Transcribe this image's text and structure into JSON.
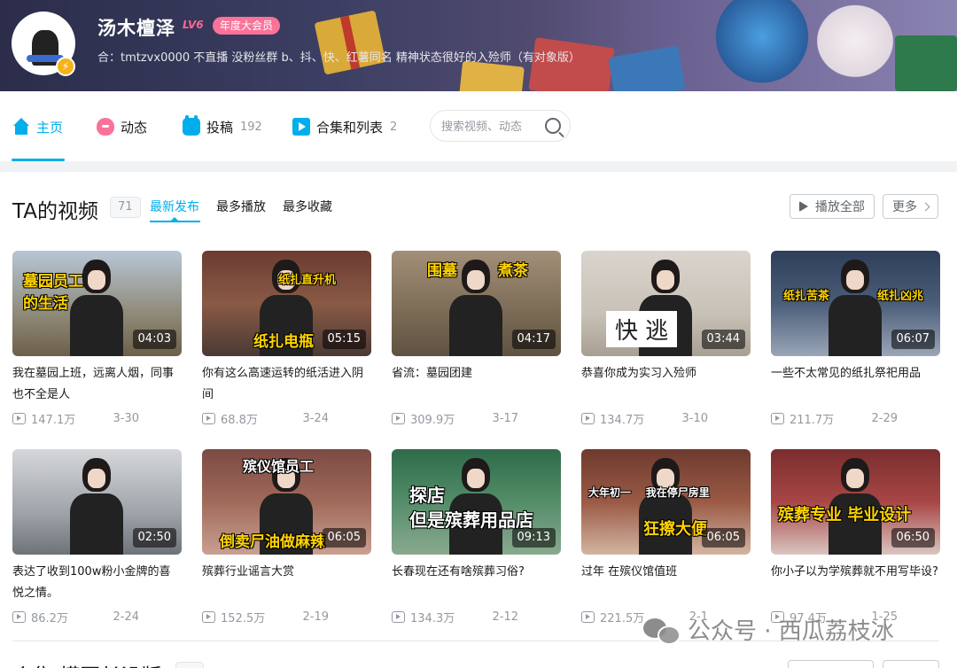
{
  "profile": {
    "username": "汤木檀泽",
    "level": "LV6",
    "vip": "年度大会员",
    "signature": "合：tmtzvx0000 不直播 没粉丝群 b、抖、快、红薯同名 精神状态很好的入殓师（有对象版）"
  },
  "nav": {
    "items": [
      {
        "label": "主页",
        "count": ""
      },
      {
        "label": "动态",
        "count": ""
      },
      {
        "label": "投稿",
        "count": "192"
      },
      {
        "label": "合集和列表",
        "count": "2"
      }
    ],
    "search_placeholder": "搜索视频、动态"
  },
  "videos_section": {
    "title": "TA的视频",
    "count": "71",
    "sort_tabs": [
      "最新发布",
      "最多播放",
      "最多收藏"
    ],
    "play_all": "播放全部",
    "more": "更多"
  },
  "videos": [
    {
      "title": "我在墓园上班，远离人烟，同事也不全是人",
      "duration": "04:03",
      "views": "147.1万",
      "date": "3-30",
      "caption": "墓园员工\n的生活"
    },
    {
      "title": "你有这么高速运转的纸活进入阴间",
      "duration": "05:15",
      "views": "68.8万",
      "date": "3-24",
      "caption": "纸扎电瓶",
      "caption2": "纸扎直升机"
    },
    {
      "title": "省流：墓园团建",
      "duration": "04:17",
      "views": "309.9万",
      "date": "3-17",
      "caption": "围墓",
      "caption2": "煮茶"
    },
    {
      "title": "恭喜你成为实习入殓师",
      "duration": "03:44",
      "views": "134.7万",
      "date": "3-10",
      "caption": "快 逃"
    },
    {
      "title": "一些不太常见的纸扎祭祀用品",
      "duration": "06:07",
      "views": "211.7万",
      "date": "2-29",
      "caption": "纸扎苦茶",
      "caption2": "纸扎凶兆"
    },
    {
      "title": "表达了收到100w粉小金牌的喜悦之情。",
      "duration": "02:50",
      "views": "86.2万",
      "date": "2-24",
      "caption": ""
    },
    {
      "title": "殡葬行业谣言大赏",
      "duration": "06:05",
      "views": "152.5万",
      "date": "2-19",
      "caption": "倒卖尸油做麻辣",
      "caption2": "殡仪馆员工"
    },
    {
      "title": "长春现在还有啥殡葬习俗?",
      "duration": "09:13",
      "views": "134.3万",
      "date": "2-12",
      "caption": "探店\n但是殡葬用品店"
    },
    {
      "title": "过年 在殡仪馆值班",
      "duration": "06:05",
      "views": "221.5万",
      "date": "2-1",
      "caption": "狂擦大便",
      "caption2": "大年初一    我在停尸房里"
    },
    {
      "title": "你小子以为学殡葬就不用写毕设?",
      "duration": "06:50",
      "views": "97.4万",
      "date": "1-25",
      "caption": "殡葬专业 毕业设计"
    }
  ],
  "section2": {
    "title": "合集 模回长沿版"
  },
  "watermark": {
    "text": "公众号 · 西瓜荔枝冰"
  },
  "colors": {
    "accent": "#00aeec",
    "pink": "#fb7299",
    "text": "#18191c",
    "muted": "#9499a0"
  }
}
